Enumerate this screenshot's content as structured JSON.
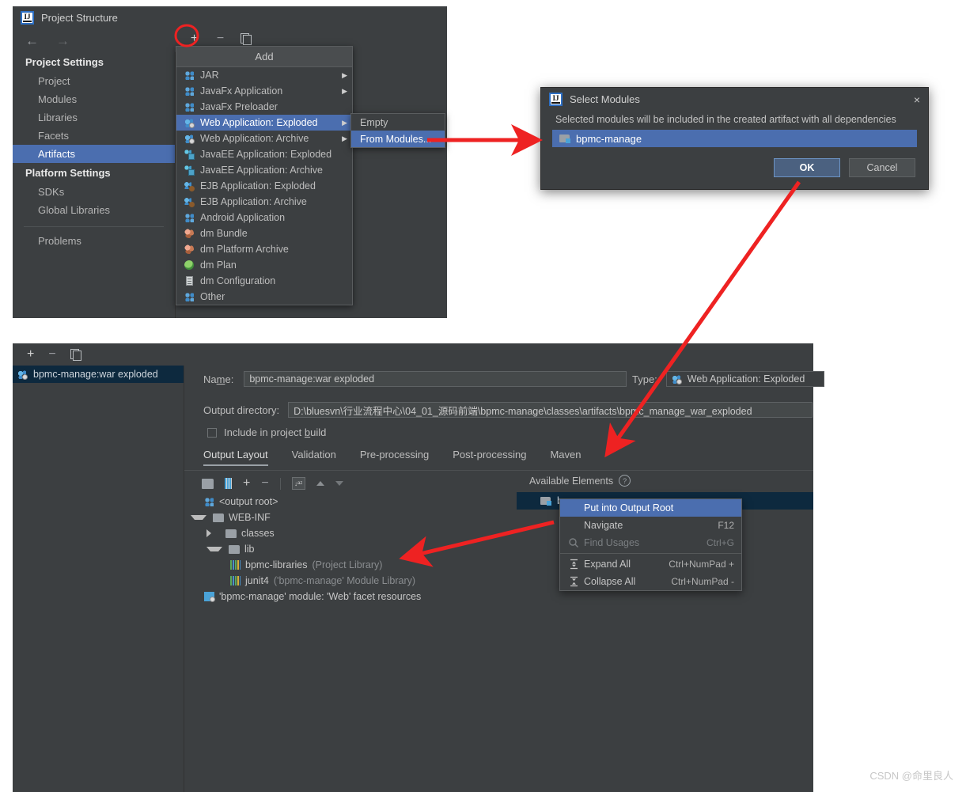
{
  "top_dialog": {
    "title": "Project Structure",
    "nav": {
      "back": "←",
      "forward": "→"
    },
    "sidebar": {
      "project_settings_header": "Project Settings",
      "project_items": [
        {
          "label": "Project"
        },
        {
          "label": "Modules"
        },
        {
          "label": "Libraries"
        },
        {
          "label": "Facets"
        },
        {
          "label": "Artifacts",
          "selected": true
        }
      ],
      "platform_settings_header": "Platform Settings",
      "platform_items": [
        {
          "label": "SDKs"
        },
        {
          "label": "Global Libraries"
        }
      ],
      "other_items": [
        {
          "label": "Problems"
        }
      ]
    },
    "toolbar": {
      "add": "+",
      "remove": "−",
      "copy": "copy-icon"
    },
    "form": {
      "name_label": "Name:",
      "name_value": "bpmc-man",
      "output_dir_label": "Output directory:",
      "output_dir_value": "",
      "include_in_build_label": "Include in project build",
      "tree": [
        {
          "label": "<output root>",
          "icon": "artifact-root-icon"
        },
        {
          "label": "WEB-INF",
          "icon": "folder-icon"
        },
        {
          "label": "'bpmc-manage",
          "icon": "facet-icon"
        }
      ]
    }
  },
  "add_menu": {
    "title": "Add",
    "items": [
      {
        "label": "JAR",
        "icon": "diamond",
        "submenu": true
      },
      {
        "label": "JavaFx Application",
        "icon": "diamond",
        "submenu": true
      },
      {
        "label": "JavaFx Preloader",
        "icon": "diamond",
        "submenu": false
      },
      {
        "label": "Web Application: Exploded",
        "icon": "web",
        "submenu": true,
        "selected": true
      },
      {
        "label": "Web Application: Archive",
        "icon": "web",
        "submenu": true
      },
      {
        "label": "JavaEE Application: Exploded",
        "icon": "jee",
        "submenu": false
      },
      {
        "label": "JavaEE Application: Archive",
        "icon": "jee",
        "submenu": false
      },
      {
        "label": "EJB Application: Exploded",
        "icon": "ejb",
        "submenu": false
      },
      {
        "label": "EJB Application: Archive",
        "icon": "ejb",
        "submenu": false
      },
      {
        "label": "Android Application",
        "icon": "diamond",
        "submenu": false
      },
      {
        "label": "dm Bundle",
        "icon": "bundle",
        "submenu": false
      },
      {
        "label": "dm Platform Archive",
        "icon": "bundle",
        "submenu": false
      },
      {
        "label": "dm Plan",
        "icon": "plan",
        "submenu": false
      },
      {
        "label": "dm Configuration",
        "icon": "cfg",
        "submenu": false
      },
      {
        "label": "Other",
        "icon": "diamond",
        "submenu": false
      }
    ]
  },
  "add_submenu": {
    "items": [
      {
        "label": "Empty",
        "selected": false
      },
      {
        "label": "From Modules...",
        "selected": true
      }
    ]
  },
  "select_modules_dialog": {
    "title": "Select Modules",
    "close": "×",
    "description": "Selected modules will be included in the created artifact with all dependencies",
    "modules": [
      {
        "label": "bpmc-manage",
        "selected": true
      }
    ],
    "ok_label": "OK",
    "cancel_label": "Cancel"
  },
  "bottom_panel": {
    "toolbar": {
      "add": "+",
      "remove": "−",
      "copy": "copy-icon"
    },
    "artifacts": [
      {
        "label": "bpmc-manage:war exploded",
        "selected": true
      }
    ],
    "name_label": "Na̱me:",
    "name_value": "bpmc-manage:war exploded",
    "type_label": "Type:",
    "type_value": "Web Application: Exploded",
    "output_dir_label": "Output directory:",
    "output_dir_value": "D:\\bluesvn\\行业流程中心\\04_01_源码前端\\bpmc-manage\\classes\\artifacts\\bpmc_manage_war_exploded",
    "include_in_build_label": "Include in project build",
    "tabs": [
      {
        "label": "Output Layout",
        "active": true
      },
      {
        "label": "Validation",
        "active": false
      },
      {
        "label": "Pre-processing",
        "active": false
      },
      {
        "label": "Post-processing",
        "active": false
      },
      {
        "label": "Maven",
        "active": false
      }
    ],
    "output_tree": [
      {
        "label": "<output root>",
        "icon": "artifact-root-icon",
        "indent": 0,
        "twisty": "none"
      },
      {
        "label": "WEB-INF",
        "icon": "folder-icon",
        "indent": 1,
        "twisty": "open"
      },
      {
        "label": "classes",
        "icon": "folder-icon",
        "indent": 2,
        "twisty": "closed"
      },
      {
        "label": "lib",
        "icon": "folder-icon",
        "indent": 2,
        "twisty": "open"
      },
      {
        "label": "bpmc-libraries",
        "suffix": "(Project Library)",
        "icon": "library-icon",
        "indent": 3,
        "twisty": "none"
      },
      {
        "label": "junit4",
        "suffix": "('bpmc-manage' Module Library)",
        "icon": "library-icon",
        "indent": 3,
        "twisty": "none"
      },
      {
        "label": "'bpmc-manage' module: 'Web' facet resources",
        "icon": "facet-icon",
        "indent": 1,
        "twisty": "none"
      }
    ],
    "available_elements": {
      "header": "Available Elements",
      "help": "?",
      "items": [
        {
          "label": "bpmc-manage",
          "selected": true
        }
      ]
    }
  },
  "context_menu": {
    "items": [
      {
        "label": "Put into Output Root",
        "shortcut": "",
        "selected": true,
        "disabled": false,
        "icon": "none"
      },
      {
        "label": "Navigate",
        "shortcut": "F12",
        "selected": false,
        "disabled": false,
        "icon": "none"
      },
      {
        "label": "Find Usages",
        "shortcut": "Ctrl+G",
        "selected": false,
        "disabled": true,
        "icon": "search-icon"
      },
      {
        "label": "Expand All",
        "shortcut": "Ctrl+NumPad +",
        "selected": false,
        "disabled": false,
        "icon": "expand-all-icon",
        "separator_before": true
      },
      {
        "label": "Collapse All",
        "shortcut": "Ctrl+NumPad -",
        "selected": false,
        "disabled": false,
        "icon": "collapse-all-icon"
      }
    ]
  },
  "watermark": {
    "text": "CSDN @命里良人"
  },
  "colors": {
    "panel_bg": "#3c3f41",
    "selection_blue": "#4b6eaf",
    "tree_selection": "#0d293e",
    "annotation_red": "#ee2222",
    "accent_icon_blue": "#4aa3d8",
    "text": "#bbbbbb"
  }
}
